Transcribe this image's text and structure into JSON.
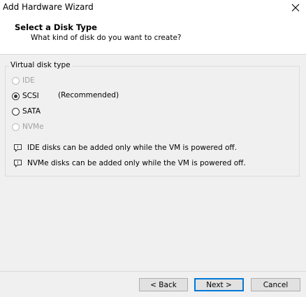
{
  "window": {
    "title": "Add Hardware Wizard",
    "close_glyph": "✕"
  },
  "header": {
    "title": "Select a Disk Type",
    "subtitle": "What kind of disk do you want to create?"
  },
  "disk_type": {
    "group_label": "Virtual disk type",
    "options": [
      {
        "label": "IDE",
        "checked": false,
        "enabled": false
      },
      {
        "label": "SCSI",
        "checked": true,
        "enabled": true,
        "note": "(Recommended)"
      },
      {
        "label": "SATA",
        "checked": false,
        "enabled": true
      },
      {
        "label": "NVMe",
        "checked": false,
        "enabled": false
      }
    ]
  },
  "info_messages": [
    {
      "text": "IDE disks can be added only while the VM is powered off.",
      "icon": "comment-info-icon"
    },
    {
      "text": "NVMe disks can be added only while the VM is powered off.",
      "icon": "comment-info-icon"
    }
  ],
  "buttons": {
    "back": "< Back",
    "next": "Next >",
    "cancel": "Cancel"
  }
}
